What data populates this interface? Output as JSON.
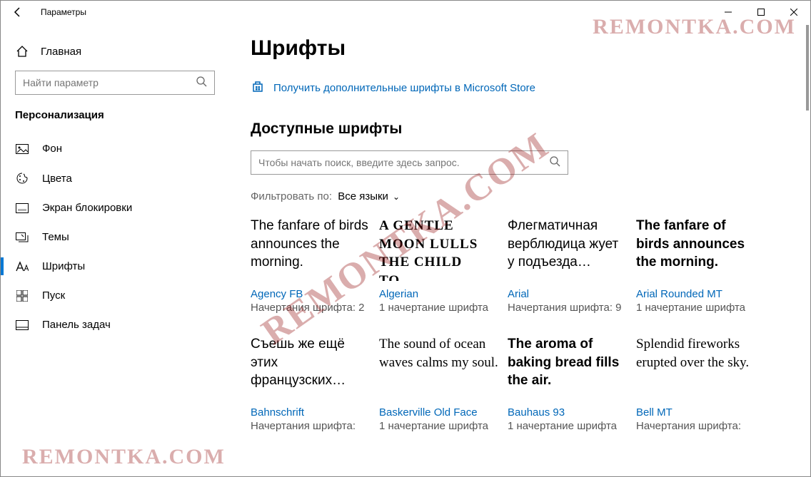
{
  "window": {
    "title": "Параметры"
  },
  "sidebar": {
    "home": "Главная",
    "search_placeholder": "Найти параметр",
    "category": "Персонализация",
    "items": [
      {
        "label": "Фон"
      },
      {
        "label": "Цвета"
      },
      {
        "label": "Экран блокировки"
      },
      {
        "label": "Темы"
      },
      {
        "label": "Шрифты"
      },
      {
        "label": "Пуск"
      },
      {
        "label": "Панель задач"
      }
    ]
  },
  "main": {
    "title": "Шрифты",
    "store_link": "Получить дополнительные шрифты в Microsoft Store",
    "available_title": "Доступные шрифты",
    "search_placeholder": "Чтобы начать поиск, введите здесь запрос.",
    "filter_label": "Фильтровать по:",
    "filter_value": "Все языки"
  },
  "fonts": [
    {
      "preview": "The fanfare of birds announces the morning.",
      "name": "Agency FB",
      "faces": "Начертания шрифта: 2",
      "cls": "fp-agency"
    },
    {
      "preview": "A gentle moon lulls the child to…",
      "name": "Algerian",
      "faces": "1 начертание шрифта",
      "cls": "fp-algerian"
    },
    {
      "preview": "Флегматичная верблюдица жует у подъезда…",
      "name": "Arial",
      "faces": "Начертания шрифта: 9",
      "cls": "fp-arial"
    },
    {
      "preview": "The fanfare of birds announces the morning.",
      "name": "Arial Rounded MT",
      "faces": "1 начертание шрифта",
      "cls": "fp-arialr"
    },
    {
      "preview": "Съешь же ещё этих французских…",
      "name": "Bahnschrift",
      "faces": "Начертания шрифта:",
      "cls": "fp-bahn"
    },
    {
      "preview": "The sound of ocean waves calms my soul.",
      "name": "Baskerville Old Face",
      "faces": "1 начертание шрифта",
      "cls": "fp-bask"
    },
    {
      "preview": "The aroma of baking bread fills the air.",
      "name": "Bauhaus 93",
      "faces": "1 начертание шрифта",
      "cls": "fp-bauhaus"
    },
    {
      "preview": "Splendid fireworks erupted over the sky.",
      "name": "Bell MT",
      "faces": "Начертания шрифта:",
      "cls": "fp-bell"
    }
  ],
  "watermark": "REMONTKA.COM"
}
